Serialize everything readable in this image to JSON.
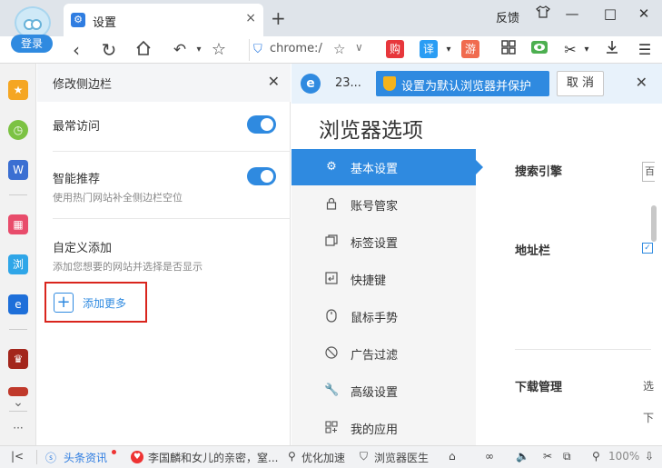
{
  "titlebar": {
    "login_label": "登录",
    "tab_title": "设置",
    "tab_close": "×",
    "new_tab": "+",
    "feedback": "反馈",
    "minimize": "—",
    "maximize": "□",
    "close": "✕"
  },
  "addressbar": {
    "url": "chrome:/",
    "ext_labels": [
      "购",
      "译",
      "游"
    ],
    "colors": {
      "shop": "#e7373c",
      "translate": "#2a9df4",
      "game": "#f06b4f",
      "eye": "#4caf50"
    }
  },
  "strip": {
    "icons": [
      "star-icon",
      "clock-icon",
      "word-doc-icon",
      "app-store-icon",
      "browser-icon",
      "edge-icon",
      "game-icon"
    ],
    "browser_label": "浏",
    "word_label": "W",
    "more": "···"
  },
  "panel": {
    "title": "修改侧边栏",
    "frequent": {
      "title": "最常访问",
      "enabled": true
    },
    "smart": {
      "title": "智能推荐",
      "subtitle": "使用热门网站补全侧边栏空位",
      "enabled": true
    },
    "custom": {
      "title": "自定义添加",
      "subtitle": "添加您想要的网站并选择是否显示"
    },
    "add_more": "添加更多"
  },
  "infobar": {
    "count": "23...",
    "set_default": "设置为默认浏览器并保护",
    "cancel": "取 消"
  },
  "options": {
    "title": "浏览器选项",
    "menu": [
      {
        "label": "基本设置",
        "icon": "gear-icon",
        "active": true
      },
      {
        "label": "账号管家",
        "icon": "lock-icon",
        "active": false
      },
      {
        "label": "标签设置",
        "icon": "tabs-icon",
        "active": false
      },
      {
        "label": "快捷键",
        "icon": "shortcut-icon",
        "active": false
      },
      {
        "label": "鼠标手势",
        "icon": "mouse-icon",
        "active": false
      },
      {
        "label": "广告过滤",
        "icon": "block-icon",
        "active": false
      },
      {
        "label": "高级设置",
        "icon": "wrench-icon",
        "active": false
      },
      {
        "label": "我的应用",
        "icon": "apps-icon",
        "active": false
      }
    ],
    "sections": {
      "search": "搜索引擎",
      "address": "地址栏",
      "download": "下载管理"
    },
    "search_stub": "百",
    "download_texts": [
      "选",
      "下"
    ]
  },
  "statusbar": {
    "news": "头条资讯",
    "headline": "李国麟和女儿的亲密，窒...",
    "optimize": "优化加速",
    "doctor": "浏览器医生",
    "zoom": "100%"
  }
}
